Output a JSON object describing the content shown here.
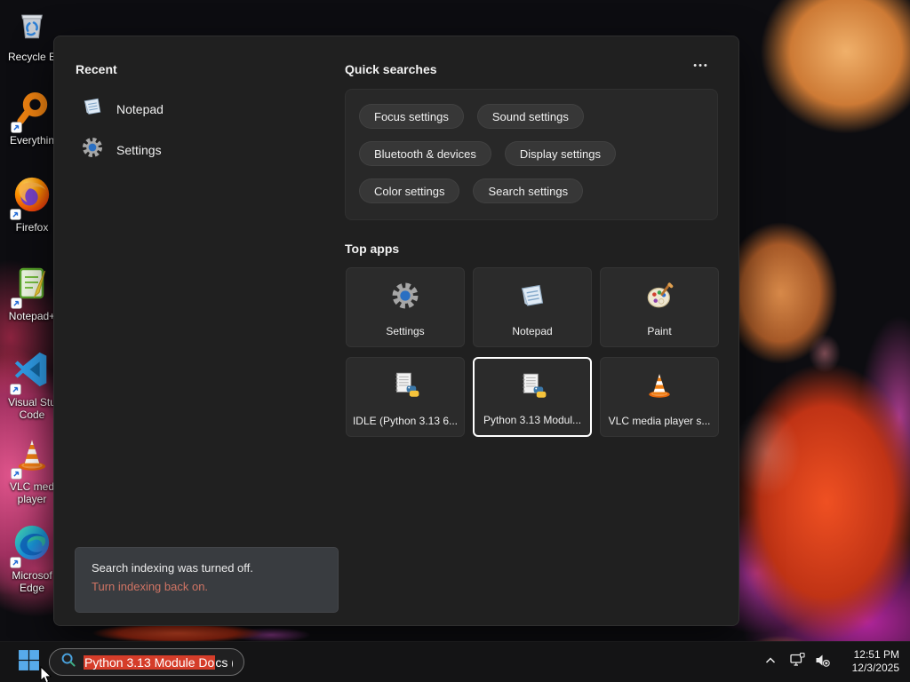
{
  "colors": {
    "selection_red": "#d53d2a",
    "toast_link_salmon": "#cf7464",
    "accent_blue": "#57aaea"
  },
  "desktop": {
    "icons": [
      {
        "icon": "recycle-bin-icon",
        "line1": "Recycle B",
        "line2": ""
      },
      {
        "icon": "everything-search-icon",
        "line1": "Everythin",
        "line2": ""
      },
      {
        "icon": "firefox-icon",
        "line1": "Firefox",
        "line2": ""
      },
      {
        "icon": "notepad-plus-plus-icon",
        "line1": "Notepad+",
        "line2": ""
      },
      {
        "icon": "vscode-icon",
        "line1": "Visual Stu",
        "line2": "Code"
      },
      {
        "icon": "vlc-icon",
        "line1": "VLC med",
        "line2": "player"
      },
      {
        "icon": "edge-icon",
        "line1": "Microsof",
        "line2": "Edge"
      }
    ]
  },
  "panel": {
    "recent": {
      "title": "Recent",
      "items": [
        {
          "icon": "notepad-icon",
          "label": "Notepad"
        },
        {
          "icon": "settings-gear-icon",
          "label": "Settings"
        }
      ]
    },
    "quick_searches": {
      "title": "Quick searches",
      "more_label": "•••",
      "pills": [
        "Focus settings",
        "Sound settings",
        "Bluetooth & devices",
        "Display settings",
        "Color settings",
        "Search settings"
      ]
    },
    "top_apps": {
      "title": "Top apps",
      "tiles": [
        {
          "icon": "settings-gear-icon",
          "label": "Settings",
          "selected": false
        },
        {
          "icon": "notepad-icon",
          "label": "Notepad",
          "selected": false
        },
        {
          "icon": "paint-icon",
          "label": "Paint",
          "selected": false
        },
        {
          "icon": "python-doc-icon",
          "label": "IDLE (Python 3.13 6...",
          "selected": false
        },
        {
          "icon": "python-doc-icon",
          "label": "Python 3.13 Modul...",
          "selected": true
        },
        {
          "icon": "vlc-icon",
          "label": "VLC media player s...",
          "selected": false
        }
      ]
    },
    "toast": {
      "message": "Search indexing was turned off.",
      "link": "Turn indexing back on."
    }
  },
  "taskbar": {
    "search": {
      "selected_text": "Python 3.13 Module Do",
      "rest_text": "cs ("
    },
    "tray": {
      "time": "12:51 PM",
      "date": "12/3/2025"
    }
  }
}
